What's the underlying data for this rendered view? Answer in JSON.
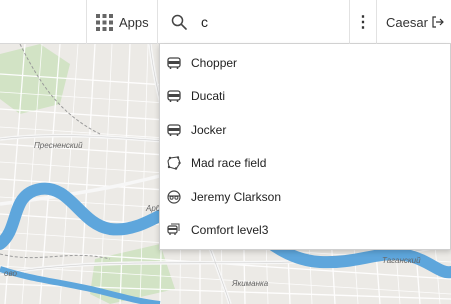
{
  "header": {
    "apps_label": "Apps",
    "search_value": "c",
    "more_glyph": "⋮",
    "user_name": "Caesar",
    "logout_icon": "logout-icon"
  },
  "suggestions": [
    {
      "label": "Chopper",
      "icon": "bus-icon"
    },
    {
      "label": "Ducati",
      "icon": "bus-icon"
    },
    {
      "label": "Jocker",
      "icon": "bus-icon"
    },
    {
      "label": "Mad race field",
      "icon": "geofence-icon"
    },
    {
      "label": "Jeremy Clarkson",
      "icon": "driver-icon"
    },
    {
      "label": "Comfort level3",
      "icon": "bus-group-icon"
    }
  ],
  "map": {
    "labels": [
      "Пресненский",
      "Арб",
      "Якиманка",
      "Таганский",
      "ово"
    ]
  },
  "colors": {
    "map_background": "#eceae6",
    "water": "#5ea6dc",
    "park": "#d2e3c5",
    "road": "#ffffff",
    "major_road": "#f4f4f4"
  }
}
